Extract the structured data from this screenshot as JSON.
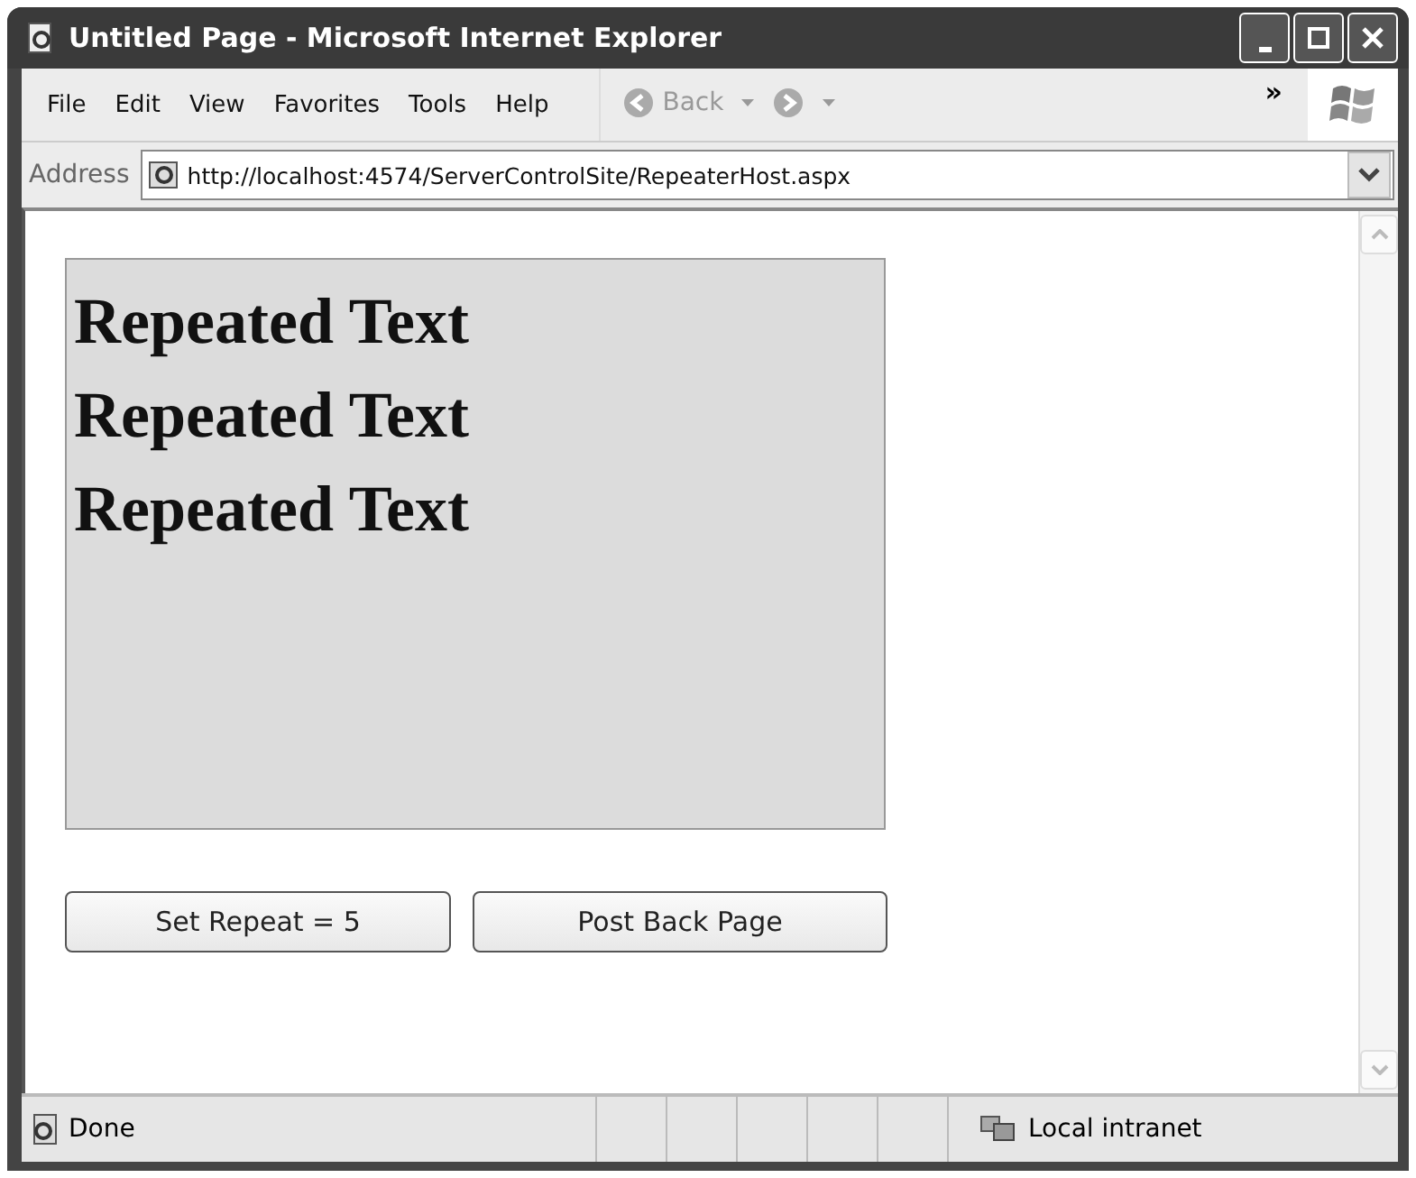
{
  "window": {
    "title": "Untitled Page - Microsoft Internet Explorer"
  },
  "menu": [
    "File",
    "Edit",
    "View",
    "Favorites",
    "Tools",
    "Help"
  ],
  "toolbar": {
    "back": {
      "label": "Back",
      "disabled": true
    },
    "forward": {
      "disabled": true
    },
    "overflow": "»"
  },
  "address": {
    "label": "Address",
    "url": "http://localhost:4574/ServerControlSite/RepeaterHost.aspx"
  },
  "repeater": {
    "items": [
      "Repeated Text",
      "Repeated Text",
      "Repeated Text"
    ]
  },
  "buttons": [
    "Set Repeat = 5",
    "Post Back Page"
  ],
  "status_bar": {
    "text": "Done",
    "zone": "Local intranet"
  }
}
